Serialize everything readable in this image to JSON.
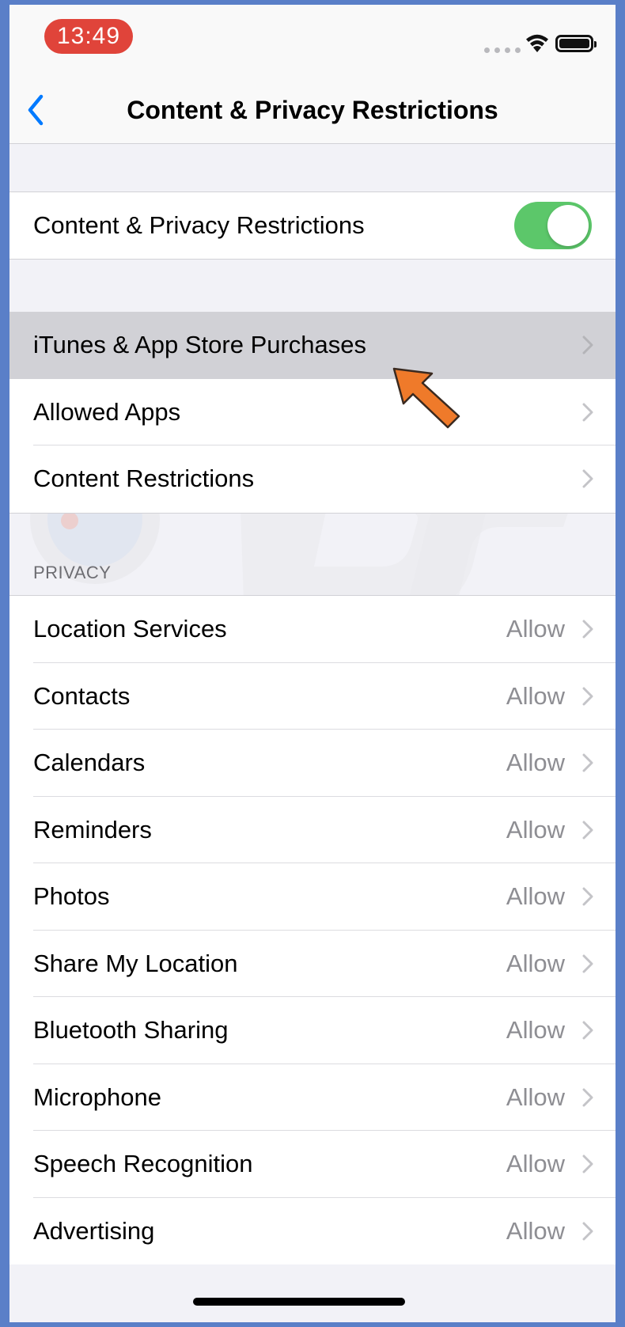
{
  "status_bar": {
    "time": "13:49"
  },
  "nav": {
    "title": "Content & Privacy Restrictions"
  },
  "toggle_row": {
    "label": "Content & Privacy Restrictions",
    "enabled": true
  },
  "store_group": {
    "items": [
      {
        "label": "iTunes & App Store Purchases"
      },
      {
        "label": "Allowed Apps"
      },
      {
        "label": "Content Restrictions"
      }
    ]
  },
  "privacy": {
    "header": "PRIVACY",
    "items": [
      {
        "label": "Location Services",
        "value": "Allow"
      },
      {
        "label": "Contacts",
        "value": "Allow"
      },
      {
        "label": "Calendars",
        "value": "Allow"
      },
      {
        "label": "Reminders",
        "value": "Allow"
      },
      {
        "label": "Photos",
        "value": "Allow"
      },
      {
        "label": "Share My Location",
        "value": "Allow"
      },
      {
        "label": "Bluetooth Sharing",
        "value": "Allow"
      },
      {
        "label": "Microphone",
        "value": "Allow"
      },
      {
        "label": "Speech Recognition",
        "value": "Allow"
      },
      {
        "label": "Advertising",
        "value": "Allow"
      }
    ]
  },
  "colors": {
    "accent": "#007aff",
    "toggle_on": "#5cc76a",
    "time_pill": "#e0443a",
    "arrow": "#ef7a2a"
  },
  "icons": [
    "back-chevron-icon",
    "wifi-icon",
    "battery-icon",
    "chevron-right-icon",
    "pointer-arrow-icon"
  ]
}
